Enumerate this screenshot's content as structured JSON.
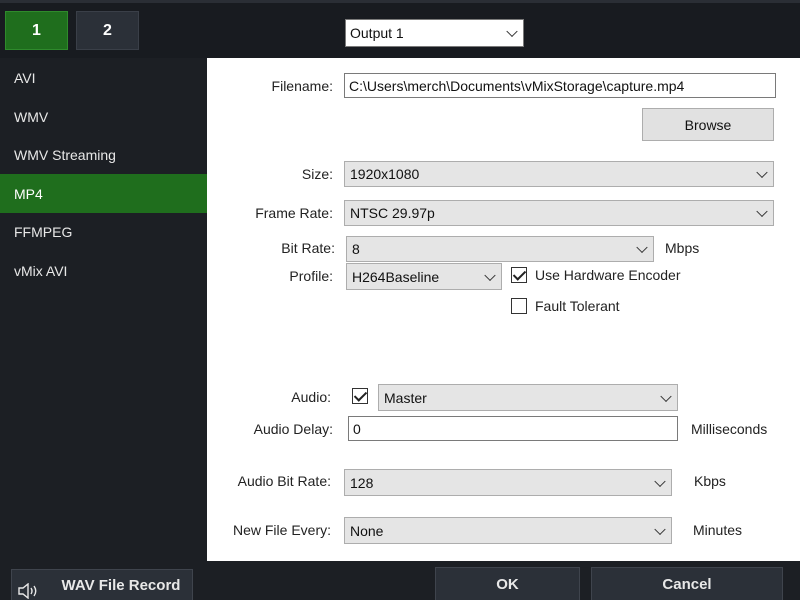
{
  "tabs": [
    {
      "label": "1",
      "active": true
    },
    {
      "label": "2",
      "active": false
    }
  ],
  "output_select": {
    "value": "Output 1"
  },
  "sidebar": {
    "items": [
      {
        "label": "AVI",
        "active": false
      },
      {
        "label": "WMV",
        "active": false
      },
      {
        "label": "WMV Streaming",
        "active": false
      },
      {
        "label": "MP4",
        "active": true
      },
      {
        "label": "FFMPEG",
        "active": false
      },
      {
        "label": "vMix AVI",
        "active": false
      }
    ]
  },
  "form": {
    "filename": {
      "label": "Filename:",
      "value": "C:\\Users\\merch\\Documents\\vMixStorage\\capture.mp4"
    },
    "browse_label": "Browse",
    "size": {
      "label": "Size:",
      "value": "1920x1080"
    },
    "frame_rate": {
      "label": "Frame Rate:",
      "value": "NTSC 29.97p"
    },
    "bit_rate": {
      "label": "Bit Rate:",
      "value": "8",
      "unit": "Mbps"
    },
    "profile": {
      "label": "Profile:",
      "value": "H264Baseline"
    },
    "use_hw_encoder": {
      "label": "Use Hardware Encoder",
      "checked": true
    },
    "fault_tolerant": {
      "label": "Fault Tolerant",
      "checked": false
    },
    "audio": {
      "label": "Audio:",
      "checked": true,
      "value": "Master"
    },
    "audio_delay": {
      "label": "Audio Delay:",
      "value": "0",
      "unit": "Milliseconds"
    },
    "audio_bit_rate": {
      "label": "Audio Bit Rate:",
      "value": "128",
      "unit": "Kbps"
    },
    "new_file_every": {
      "label": "New File Every:",
      "value": "None",
      "unit": "Minutes"
    }
  },
  "footer": {
    "wav_label": "WAV File Record",
    "ok_label": "OK",
    "cancel_label": "Cancel"
  },
  "colors": {
    "accent_green": "#1f6e1d",
    "dark_bg": "#1c1f24",
    "panel_bg": "#ffffff"
  }
}
